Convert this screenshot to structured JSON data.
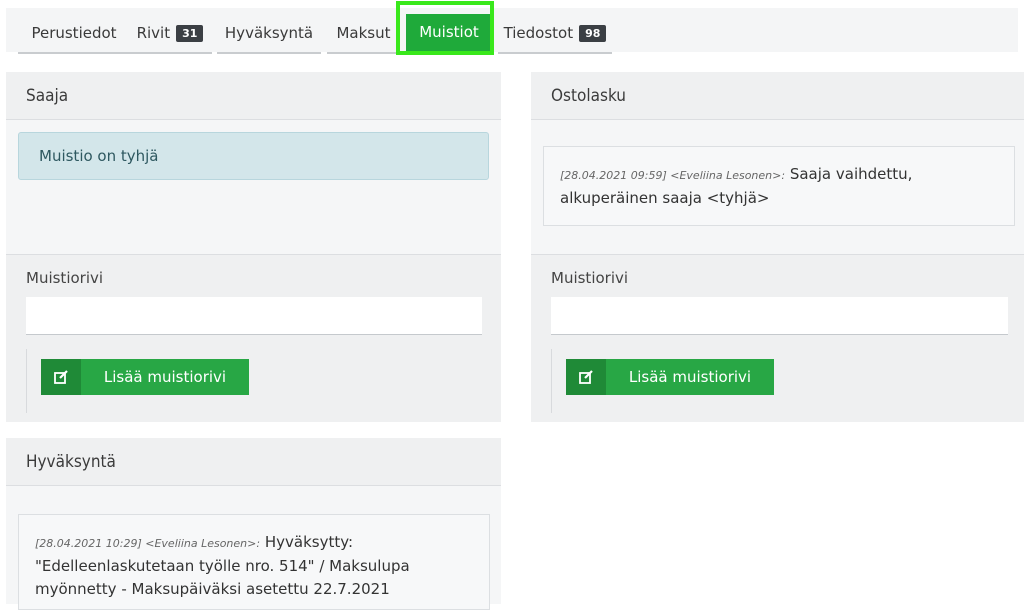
{
  "tabs": [
    {
      "label": "Perustiedot",
      "badge": null
    },
    {
      "label": "Rivit",
      "badge": "31"
    },
    {
      "label": "Hyväksyntä",
      "badge": null
    },
    {
      "label": "Maksut",
      "badge": null
    },
    {
      "label": "Muistiot",
      "badge": null,
      "active": true
    },
    {
      "label": "Tiedostot",
      "badge": "98"
    }
  ],
  "saaja": {
    "title": "Saaja",
    "empty_text": "Muistio on tyhjä",
    "form_label": "Muistiorivi",
    "input_value": "",
    "button_label": "Lisää muistiorivi"
  },
  "ostolasku": {
    "title": "Ostolasku",
    "note_meta": "[28.04.2021 09:59] <Eveliina Lesonen>:",
    "note_text": " Saaja vaihdettu, alkuperäinen saaja <tyhjä>",
    "form_label": "Muistiorivi",
    "input_value": "",
    "button_label": "Lisää muistiorivi"
  },
  "hyvaksynta": {
    "title": "Hyväksyntä",
    "note_meta": "[28.04.2021 10:29] <Eveliina Lesonen>:",
    "note_text": " Hyväksytty: \"Edelleenlaskutetaan työlle nro. 514\" / Maksulupa myönnetty - Maksupäiväksi asetettu 22.7.2021"
  },
  "colors": {
    "accent": "#1faa3a",
    "button": "#28a745",
    "highlight": "#39e81b"
  },
  "icons": {
    "add": "edit-icon"
  }
}
